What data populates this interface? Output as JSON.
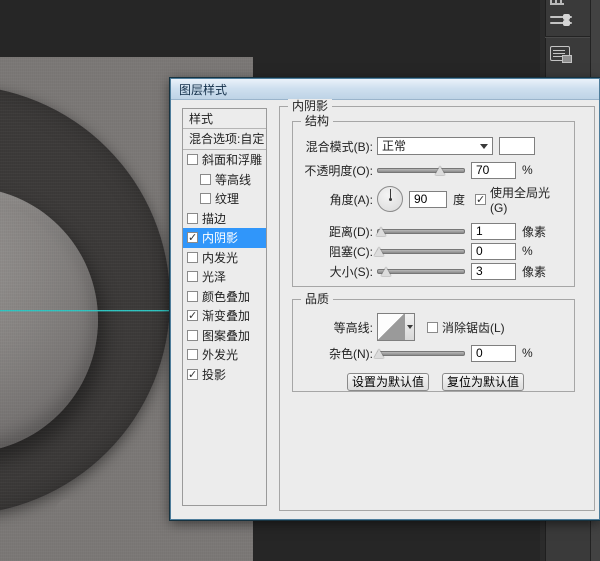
{
  "app": {
    "workspace_bg": "#262626",
    "canvas_bg": "#7b7876",
    "guide_color": "#2fc6c2",
    "selection_color": "#3096fa"
  },
  "dock": {
    "icons": [
      "grid-panel-icon",
      "brush-presets-icon",
      "clone-source-panel-icon"
    ]
  },
  "dialog": {
    "title": "图层样式",
    "panel_title": "内阴影",
    "sidebar": {
      "header": "样式",
      "blending_item": "混合选项:自定",
      "items": [
        {
          "label": "斜面和浮雕",
          "checked": false,
          "indent": false,
          "selected": false
        },
        {
          "label": "等高线",
          "checked": false,
          "indent": true,
          "selected": false
        },
        {
          "label": "纹理",
          "checked": false,
          "indent": true,
          "selected": false
        },
        {
          "label": "描边",
          "checked": false,
          "indent": false,
          "selected": false
        },
        {
          "label": "内阴影",
          "checked": true,
          "indent": false,
          "selected": true
        },
        {
          "label": "内发光",
          "checked": false,
          "indent": false,
          "selected": false
        },
        {
          "label": "光泽",
          "checked": false,
          "indent": false,
          "selected": false
        },
        {
          "label": "颜色叠加",
          "checked": false,
          "indent": false,
          "selected": false
        },
        {
          "label": "渐变叠加",
          "checked": true,
          "indent": false,
          "selected": false
        },
        {
          "label": "图案叠加",
          "checked": false,
          "indent": false,
          "selected": false
        },
        {
          "label": "外发光",
          "checked": false,
          "indent": false,
          "selected": false
        },
        {
          "label": "投影",
          "checked": true,
          "indent": false,
          "selected": false
        }
      ]
    },
    "structure_group": {
      "title": "结构",
      "blend_mode_label": "混合模式(B):",
      "blend_mode_value": "正常",
      "shadow_color": "#ffffff",
      "opacity_label": "不透明度(O):",
      "opacity_value": "70",
      "opacity_unit": "%",
      "angle_label": "角度(A):",
      "angle_value": "90",
      "angle_unit": "度",
      "global_light_label": "使用全局光(G)",
      "global_light_checked": true,
      "distance_label": "距离(D):",
      "distance_value": "1",
      "distance_unit": "像素",
      "choke_label": "阻塞(C):",
      "choke_value": "0",
      "choke_unit": "%",
      "size_label": "大小(S):",
      "size_value": "3",
      "size_unit": "像素"
    },
    "quality_group": {
      "title": "品质",
      "contour_label": "等高线:",
      "antialias_label": "消除锯齿(L)",
      "antialias_checked": false,
      "noise_label": "杂色(N):",
      "noise_value": "0",
      "noise_unit": "%"
    },
    "buttons": {
      "set_default": "设置为默认值",
      "reset_default": "复位为默认值"
    }
  }
}
